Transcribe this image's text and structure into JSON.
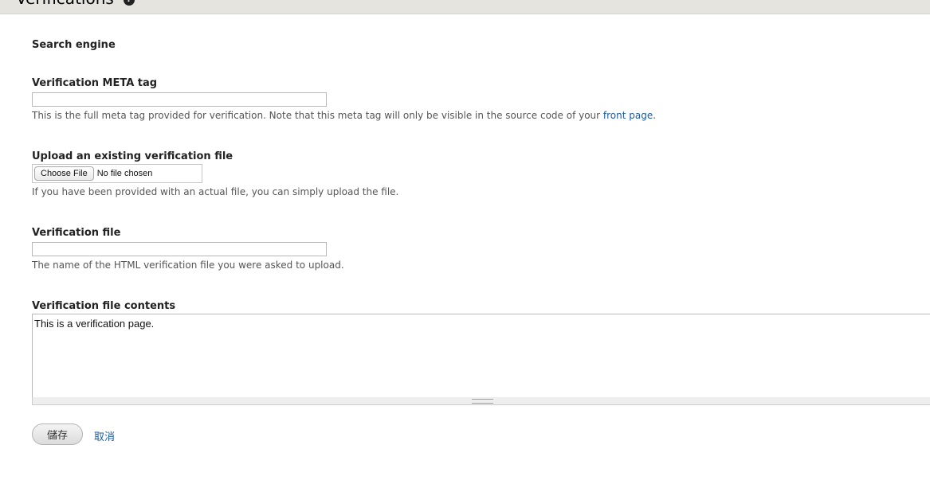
{
  "header": {
    "title": "Verifications",
    "help_icon": "help-icon"
  },
  "form": {
    "section_title": "Search engine",
    "meta_tag": {
      "label": "Verification META tag",
      "value": "",
      "description_before": "This is the full meta tag provided for verification. Note that this meta tag will only be visible in the source code of your ",
      "description_link": "front page",
      "description_after": "."
    },
    "upload": {
      "label": "Upload an existing verification file",
      "button": "Choose File",
      "status": "No file chosen",
      "description": "If you have been provided with an actual file, you can simply upload the file."
    },
    "file_name": {
      "label": "Verification file",
      "value": "",
      "description": "The name of the HTML verification file you were asked to upload."
    },
    "file_contents": {
      "label": "Verification file contents",
      "value": "This is a verification page."
    }
  },
  "actions": {
    "save": "儲存",
    "cancel": "取消"
  }
}
